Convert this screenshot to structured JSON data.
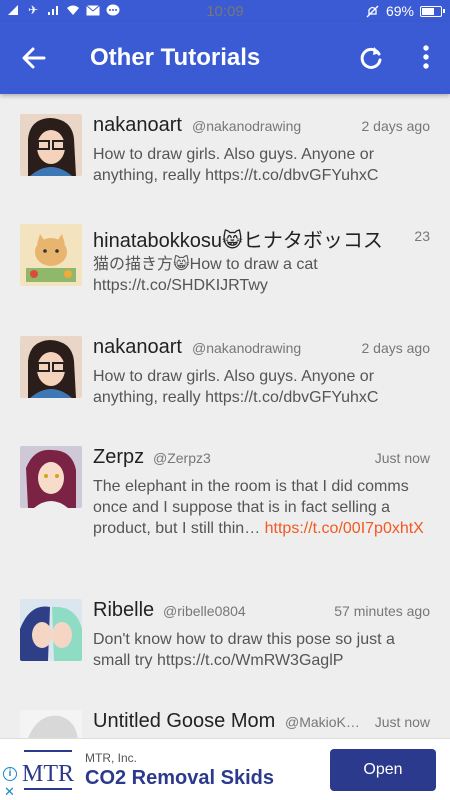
{
  "status_bar": {
    "time": "10:09",
    "battery": "69%",
    "battery_level": 0.69
  },
  "app_bar": {
    "title": "Other Tutorials"
  },
  "tweets": [
    {
      "name": "nakanoart",
      "handle": "@nakanodrawing",
      "time": "2 days ago",
      "text": "How to draw girls. Also guys. Anyone or anything, really https://t.co/dbvGFYuhxC"
    },
    {
      "name": "hinatabokkosu😸ヒナタボッコス",
      "handle": "",
      "time": "23",
      "text": "猫の描き方😸How to draw a cat https://t.co/SHDKIJRTwy"
    },
    {
      "name": "nakanoart",
      "handle": "@nakanodrawing",
      "time": "2 days ago",
      "text": "How to draw girls. Also guys. Anyone or anything, really https://t.co/dbvGFYuhxC"
    },
    {
      "name": "Zerpz",
      "handle": "@Zerpz3",
      "time": "Just now",
      "text": "The elephant in the room is that I did comms once and I suppose that is in fact selling a product, but I still thin… ",
      "link": "https://t.co/00I7p0xhtX"
    },
    {
      "name": "Ribelle",
      "handle": "@ribelle0804",
      "time": "57 minutes ago",
      "text": "Don't know how to draw this pose so just a small try https://t.co/WmRW3GaglP"
    },
    {
      "name": "Untitled Goose Mom",
      "handle": "@MakioK…",
      "time": "Just now",
      "text": ""
    }
  ],
  "ad": {
    "advertiser": "MTR, Inc.",
    "headline": "CO2 Removal Skids",
    "button": "Open",
    "logo_text": "MTR"
  }
}
